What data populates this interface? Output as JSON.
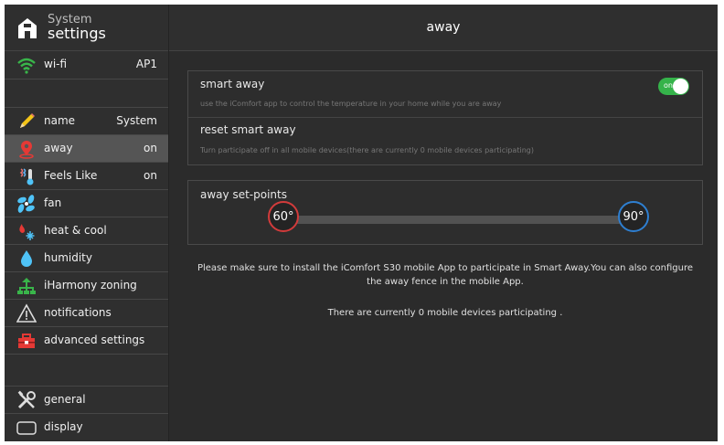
{
  "header": {
    "title_small": "System",
    "title_large": "settings"
  },
  "sidebar": {
    "wifi": {
      "label": "wi-fi",
      "value": "AP1",
      "icon": "wifi-icon"
    },
    "items": [
      {
        "label": "name",
        "value": "System",
        "icon": "pencil-icon"
      },
      {
        "label": "away",
        "value": "on",
        "icon": "location-pin-icon"
      },
      {
        "label": "Feels Like",
        "value": "on",
        "icon": "feels-like-icon"
      },
      {
        "label": "fan",
        "value": "",
        "icon": "fan-icon"
      },
      {
        "label": "heat & cool",
        "value": "",
        "icon": "flame-snowflake-icon"
      },
      {
        "label": "humidity",
        "value": "",
        "icon": "droplet-icon"
      },
      {
        "label": "iHarmony zoning",
        "value": "",
        "icon": "zoning-icon"
      },
      {
        "label": "notifications",
        "value": "",
        "icon": "warning-icon"
      },
      {
        "label": "advanced settings",
        "value": "",
        "icon": "toolbox-icon"
      }
    ],
    "bottom": [
      {
        "label": "general",
        "icon": "tools-icon"
      },
      {
        "label": "display",
        "icon": "display-icon"
      }
    ]
  },
  "main": {
    "title": "away",
    "smart_away": {
      "title": "smart away",
      "desc": "use the iComfort app to control the temperature in your home while you are away",
      "toggle_label": "on",
      "enabled": true
    },
    "reset": {
      "title": "reset smart away",
      "desc": "Turn participate off in all mobile devices(there are currently 0 mobile devices participating)"
    },
    "setpoints": {
      "title": "away set-points",
      "low": "60°",
      "high": "90°"
    },
    "message1": "Please make sure to install the iComfort S30 mobile App to participate in Smart Away.You can also configure the away fence in the mobile App.",
    "message2": "There are currently 0 mobile devices participating ."
  },
  "colors": {
    "toggle_on": "#35b34a",
    "low_setpoint": "#d23b3b",
    "high_setpoint": "#2e7fd1",
    "active_row": "#555555"
  }
}
